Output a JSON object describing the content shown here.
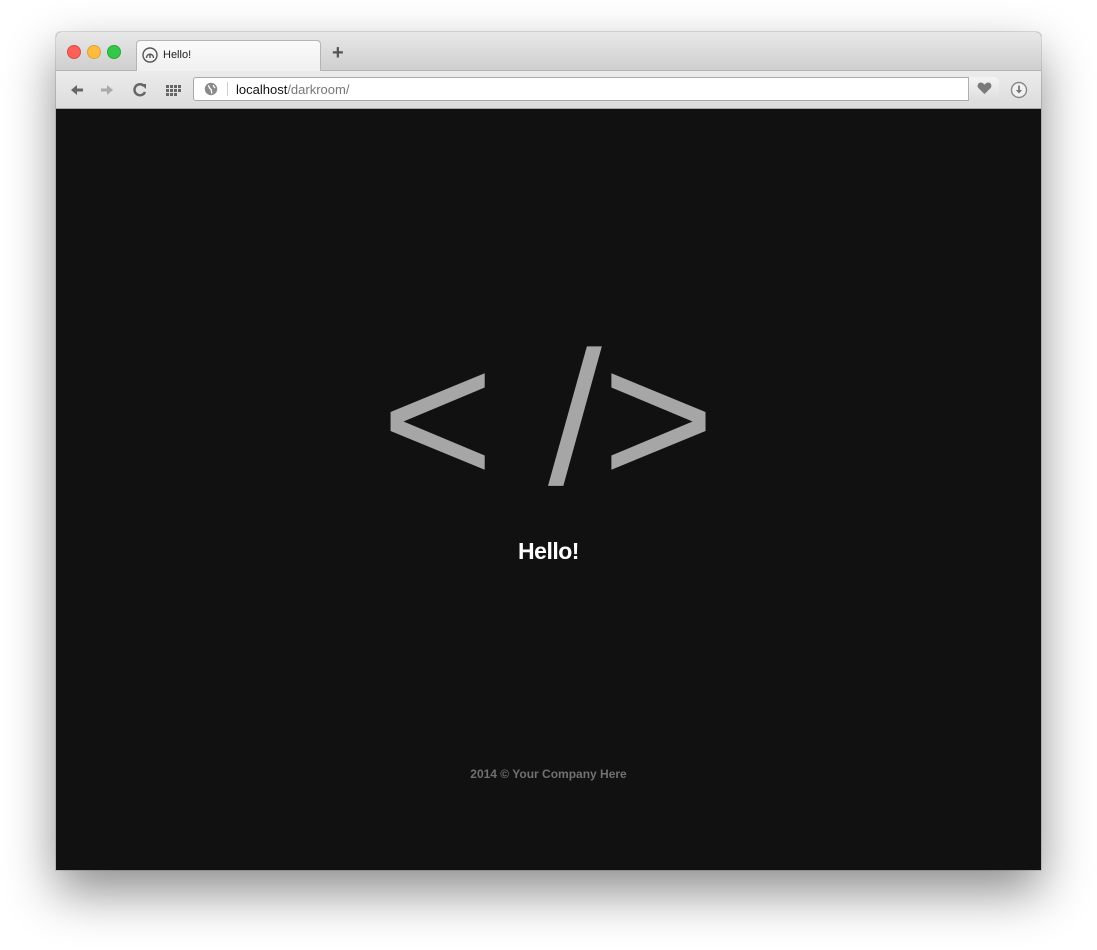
{
  "browser": {
    "tab": {
      "title": "Hello!"
    },
    "new_tab_label": "+",
    "address": {
      "host": "localhost",
      "path": "/darkroom/"
    }
  },
  "page": {
    "logo_text": "< />",
    "heading": "Hello!",
    "footer": "2014 © Your Company Here"
  },
  "colors": {
    "page_background": "#111111",
    "logo": "#a6a6a6",
    "heading": "#ffffff",
    "footer": "#707070"
  },
  "icons": [
    "close-window-button",
    "minimize-window-button",
    "maximize-window-button",
    "tab-favicon-icon",
    "back-arrow-icon",
    "forward-arrow-icon",
    "reload-icon",
    "apps-grid-icon",
    "globe-icon",
    "heart-icon",
    "download-icon"
  ]
}
